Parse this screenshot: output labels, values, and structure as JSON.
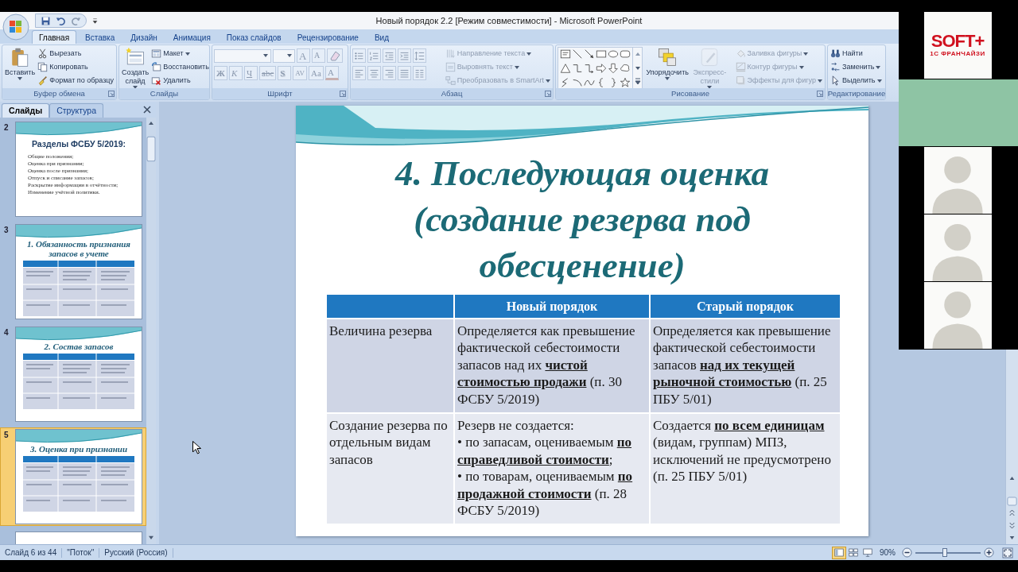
{
  "window": {
    "title": "Новый порядок 2.2 [Режим совместимости] - Microsoft PowerPoint"
  },
  "ribbon_tabs": [
    {
      "label": "Главная",
      "selected": true
    },
    {
      "label": "Вставка",
      "selected": false
    },
    {
      "label": "Дизайн",
      "selected": false
    },
    {
      "label": "Анимация",
      "selected": false
    },
    {
      "label": "Показ слайдов",
      "selected": false
    },
    {
      "label": "Рецензирование",
      "selected": false
    },
    {
      "label": "Вид",
      "selected": false
    }
  ],
  "ribbon_groups": [
    {
      "label": "Буфер обмена",
      "kind": "standard",
      "launcher": true,
      "items": [
        {
          "label": "Вставить",
          "kind": "large",
          "dropdown": true,
          "disabled": false
        },
        {
          "label": "Вырезать",
          "kind": "small",
          "dropdown": false,
          "disabled": false
        },
        {
          "label": "Копировать",
          "kind": "small",
          "dropdown": false,
          "disabled": false
        },
        {
          "label": "Формат по образцу",
          "kind": "small",
          "dropdown": false,
          "disabled": false
        }
      ]
    },
    {
      "label": "Слайды",
      "kind": "standard",
      "launcher": false,
      "items": [
        {
          "label": "Создать слайд",
          "kind": "large",
          "dropdown": true,
          "disabled": false
        },
        {
          "label": "Макет",
          "kind": "small",
          "dropdown": true,
          "disabled": false
        },
        {
          "label": "Восстановить",
          "kind": "small",
          "dropdown": false,
          "disabled": false
        },
        {
          "label": "Удалить",
          "kind": "small",
          "dropdown": false,
          "disabled": false
        }
      ]
    },
    {
      "label": "Шрифт",
      "kind": "font",
      "launcher": true,
      "size_buttons": [
        {
          "label": "A",
          "kind": "grow",
          "disabled": true
        },
        {
          "label": "A",
          "kind": "shrink",
          "disabled": true
        }
      ],
      "format_buttons": [
        {
          "label": "Ж",
          "kind": "bold",
          "disabled": true
        },
        {
          "label": "К",
          "kind": "italic",
          "disabled": true
        },
        {
          "label": "Ч",
          "kind": "underline",
          "disabled": true
        },
        {
          "label": "abc",
          "kind": "strike",
          "disabled": true
        },
        {
          "label": "S",
          "kind": "shadow",
          "disabled": true
        },
        {
          "label": "AV",
          "kind": "spacing",
          "disabled": true
        },
        {
          "label": "Aa",
          "kind": "case",
          "disabled": true
        },
        {
          "label": "A",
          "kind": "color",
          "disabled": true
        }
      ]
    },
    {
      "label": "Абзац",
      "kind": "paragraph",
      "launcher": true,
      "items": [
        {
          "label": "Направление текста",
          "kind": "small",
          "dropdown": true,
          "disabled": true
        },
        {
          "label": "Выровнять текст",
          "kind": "small",
          "dropdown": true,
          "disabled": true
        },
        {
          "label": "Преобразовать в SmartArt",
          "kind": "small",
          "dropdown": true,
          "disabled": true
        }
      ]
    },
    {
      "label": "Рисование",
      "kind": "drawing",
      "launcher": true,
      "items": [
        {
          "label": "Упорядочить",
          "kind": "large",
          "dropdown": true,
          "disabled": false
        },
        {
          "label": "Экспресс-стили",
          "kind": "large",
          "dropdown": true,
          "disabled": true
        },
        {
          "label": "Заливка фигуры",
          "kind": "small",
          "dropdown": true,
          "disabled": true
        },
        {
          "label": "Контур фигуры",
          "kind": "small",
          "dropdown": true,
          "disabled": true
        },
        {
          "label": "Эффекты для фигур",
          "kind": "small",
          "dropdown": true,
          "disabled": true
        }
      ]
    },
    {
      "label": "Редактирование",
      "kind": "standard",
      "launcher": false,
      "items": [
        {
          "label": "Найти",
          "kind": "small",
          "dropdown": false,
          "disabled": false
        },
        {
          "label": "Заменить",
          "kind": "small",
          "dropdown": true,
          "disabled": false
        },
        {
          "label": "Выделить",
          "kind": "small",
          "dropdown": true,
          "disabled": false
        }
      ]
    }
  ],
  "slides_pane": {
    "tabs": [
      {
        "label": "Слайды",
        "selected": true
      },
      {
        "label": "Структура",
        "selected": false
      }
    ],
    "thumbnails": [
      {
        "number": "2",
        "kind": "bullets",
        "title": "Разделы ФСБУ 5/2019:",
        "bullets": [
          "Общие положения;",
          "Оценка при признании;",
          "Оценка после признания;",
          "Отпуск и списание запасов;",
          "Раскрытие информации в отчётности;",
          "Изменение учётной политики."
        ],
        "selected": false
      },
      {
        "number": "3",
        "kind": "table",
        "title": "1. Обязанность признания запасов в учете",
        "selected": false
      },
      {
        "number": "4",
        "kind": "table",
        "title": "2. Состав запасов",
        "selected": false
      },
      {
        "number": "5",
        "kind": "table",
        "title": "3. Оценка при признании",
        "selected": true
      },
      {
        "kind": "cut",
        "selected": false
      }
    ]
  },
  "slide": {
    "title": "4. Последующая оценка (создание резерва под обесценение)",
    "table": {
      "columns": [
        "Новый порядок",
        "Старый порядок"
      ],
      "rows": [
        {
          "label": "Величина резерва",
          "cells": [
            [
              "Определяется как превышение фактической себестоимости запасов над их **чистой стоимостью продажи** (п. 30 ФСБУ 5/2019)"
            ],
            [
              "Определяется как превышение фактической себестоимости запасов **над их текущей рыночной стоимостью** (п. 25 ПБУ 5/01)"
            ]
          ]
        },
        {
          "label": "Создание резерва по отдельным видам запасов",
          "cells": [
            [
              "Резерв не создается:",
              "• по запасам, оцениваемым **по справедливой стоимости**;",
              "• по товарам, оцениваемым **по продажной стоимости** (п. 28 ФСБУ 5/2019)"
            ],
            [
              "Создается **по всем единицам** (видам, группам) МПЗ, исключений не предусмотрено (п. 25 ПБУ 5/01)"
            ]
          ]
        }
      ]
    }
  },
  "status_bar": {
    "slide_info": "Слайд 6 из 44",
    "theme": "\"Поток\"",
    "language": "Русский (Россия)",
    "views": [
      {
        "kind": "normal",
        "selected": true
      },
      {
        "kind": "sorter",
        "selected": false
      },
      {
        "kind": "show",
        "selected": false
      }
    ],
    "zoom": "90%",
    "zoom_slider": {
      "level": 0.45
    }
  },
  "video_call": {
    "tiles": [
      {
        "kind": "logo",
        "logo_text": "SOFT+",
        "logo_subtitle": "1С ФРАНЧАЙЗИ"
      },
      {
        "kind": "camera"
      },
      {
        "kind": "avatar"
      },
      {
        "kind": "avatar"
      },
      {
        "kind": "avatar"
      }
    ]
  }
}
